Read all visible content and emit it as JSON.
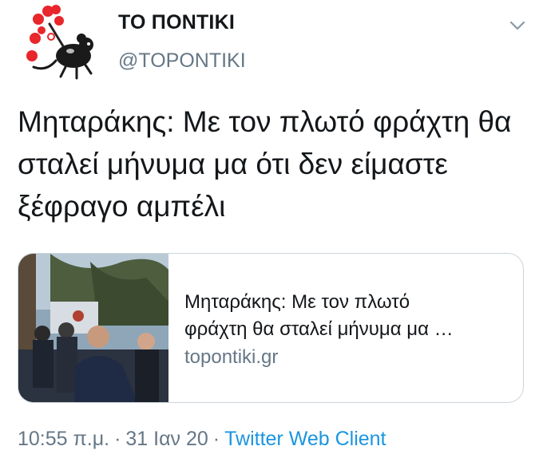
{
  "account": {
    "name": "ΤΟ ΠΟΝΤΙΚΙ",
    "handle": "@TOPONTIKI",
    "avatar_icon": "mouse-pinwheel-logo"
  },
  "menu": {
    "icon": "chevron-down-icon"
  },
  "tweet": {
    "text": "Μηταράκης: Με τον πλωτό φράχτη θα σταλεί μήνυμα μα ότι δεν είμαστε ξέφραγο αμπέλι"
  },
  "card": {
    "title_line1": "Μηταράκης: Με τον πλωτό",
    "title_line2": "φράχτη θα σταλεί μήνυμα μα …",
    "domain": "topontiki.gr"
  },
  "meta": {
    "time": "10:55 π.μ.",
    "separator": "·",
    "date": "31 Ιαν 20",
    "source": "Twitter Web Client"
  },
  "colors": {
    "secondary_text": "#657786",
    "link": "#1b95e0",
    "border": "#ccd6dd",
    "logo_red": "#e8262b"
  }
}
